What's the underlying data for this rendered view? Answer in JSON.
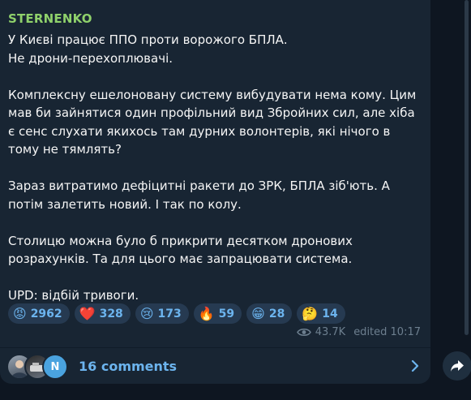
{
  "post": {
    "channel": "STERNENKO",
    "paragraphs": [
      "У Києві працює ППО проти ворожого БПЛА.\nНе дрони-перехоплювачі.",
      "Комплексну ешелоновану систему вибудувати нема кому. Цим мав би зайнятися один профільний вид Збройних сил, але хіба є сенс слухати якихось там дурних волонтерів, які нічого в тому не тямлять?",
      "Зараз витратимо дефіцитні ракети до ЗРК, БПЛА зіб'ють. А потім залетить новий. І так по колу.",
      "Столицю можна було б прикрити десятком дронових розрахунків. Та для цього має запрацювати система.",
      "UPD: відбій тривоги."
    ],
    "reactions": [
      {
        "emoji": "😡",
        "count": "2962"
      },
      {
        "emoji": "❤️",
        "count": "328"
      },
      {
        "emoji": "😢",
        "count": "173"
      },
      {
        "emoji": "🔥",
        "count": "59"
      },
      {
        "emoji": "😁",
        "count": "28"
      },
      {
        "emoji": "🤔",
        "count": "14"
      }
    ],
    "views": "43.7K",
    "edited": "edited 10:17"
  },
  "comments": {
    "label": "16 comments",
    "avatar_initial": "N"
  },
  "colors": {
    "background": "#0e1621",
    "bubble": "#182533",
    "channel_name": "#8fd16b",
    "accent": "#6cb4ee",
    "reaction_bg": "#263a51",
    "meta": "#6d7f8f"
  },
  "icons": [
    "eye-icon",
    "chevron-right-icon",
    "share-icon"
  ]
}
